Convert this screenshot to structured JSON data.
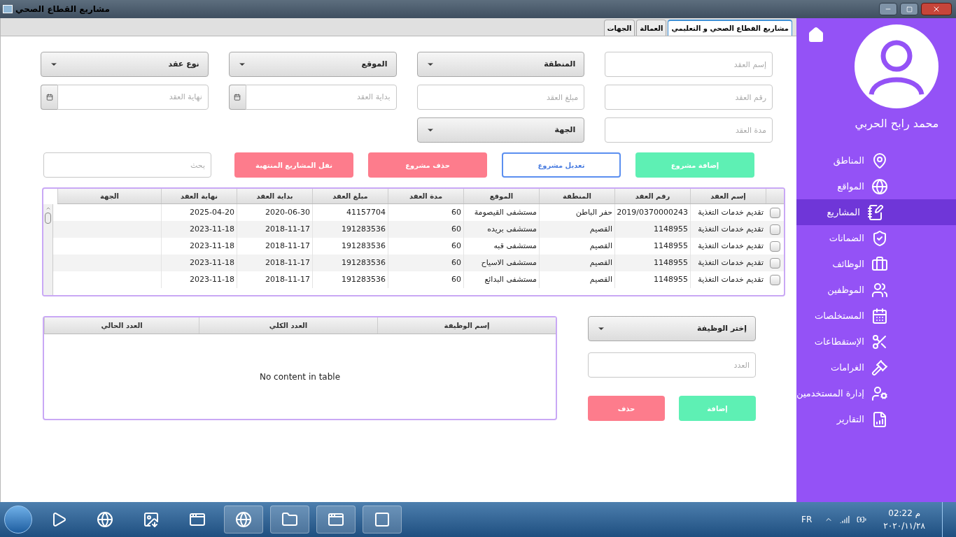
{
  "window": {
    "title": "مشاريع القطاع الصحي"
  },
  "tabs": [
    {
      "label": "مشاريع القطاع الصحي و التعليمي",
      "selected": true
    },
    {
      "label": "العمالة",
      "selected": false
    },
    {
      "label": "الجهات",
      "selected": false
    }
  ],
  "form": {
    "fields": [
      {
        "kind": "text",
        "placeholder": "إسم العقد"
      },
      {
        "kind": "combo",
        "label": "المنطقة"
      },
      {
        "kind": "combo",
        "label": "الموقع"
      },
      {
        "kind": "combo",
        "label": "نوع عقد"
      },
      {
        "kind": "text",
        "placeholder": "رقم العقد"
      },
      {
        "kind": "text",
        "placeholder": "مبلغ العقد"
      },
      {
        "kind": "date",
        "placeholder": "بداية العقد"
      },
      {
        "kind": "date",
        "placeholder": "نهاية العقد"
      },
      {
        "kind": "text",
        "placeholder": "مدة العقد"
      },
      {
        "kind": "combo",
        "label": "الجهة"
      }
    ]
  },
  "actions": [
    {
      "kind": "add",
      "label": "إضافة مشروع"
    },
    {
      "kind": "edit",
      "label": "تعديل مشروع"
    },
    {
      "kind": "delete",
      "label": "حذف مشروع"
    },
    {
      "kind": "delete",
      "label": "نقل المشاريع المنتهية"
    }
  ],
  "search": {
    "placeholder": "بحث"
  },
  "table": {
    "columns": [
      "إسم العقد",
      "رقم العقد",
      "المنطقة",
      "الموقع",
      "مدة العقد",
      "مبلغ العقد",
      "بداية العقد",
      "نهاية العقد",
      "الجهة"
    ],
    "rows": [
      {
        "checked": false,
        "cells": [
          "تقديم خدمات التغذية",
          "2019/0370000243",
          "حفر الباطن",
          "مستشفى القيصومة",
          "60",
          "41157704",
          "2020-06-30",
          "2025-04-20"
        ]
      },
      {
        "checked": false,
        "cells": [
          "تقديم خدمات التغذية",
          "1148955",
          "القصيم",
          "مستشفى بريده",
          "60",
          "191283536",
          "2018-11-17",
          "2023-11-18"
        ]
      },
      {
        "checked": false,
        "cells": [
          "تقديم خدمات التغذية",
          "1148955",
          "القصيم",
          "مستشفى قبه",
          "60",
          "191283536",
          "2018-11-17",
          "2023-11-18"
        ]
      },
      {
        "checked": false,
        "cells": [
          "تقديم خدمات التغذية",
          "1148955",
          "القصيم",
          "مستشفى الاسياح",
          "60",
          "191283536",
          "2018-11-17",
          "2023-11-18"
        ]
      },
      {
        "checked": false,
        "cells": [
          "تقديم خدمات التغذية",
          "1148955",
          "القصيم",
          "مستشفى البدائع",
          "60",
          "191283536",
          "2018-11-17",
          "2023-11-18"
        ]
      }
    ]
  },
  "jobs": {
    "combo_label": "إختر الوظيفة",
    "count_placeholder": "العدد",
    "actions": [
      {
        "kind": "add",
        "label": "إضافة"
      },
      {
        "kind": "delete",
        "label": "حذف"
      }
    ],
    "columns": [
      "إسم الوظيفة",
      "العدد الكلي",
      "العدد الحالي"
    ],
    "empty_text": "No content in table"
  },
  "sidebar": {
    "user_name": "محمد رابح الحربي",
    "items": [
      {
        "label": "المناطق",
        "selected": false
      },
      {
        "label": "المواقع",
        "selected": false
      },
      {
        "label": "المشاريع",
        "selected": true
      },
      {
        "label": "الضمانات",
        "selected": false
      },
      {
        "label": "الوظائف",
        "selected": false
      },
      {
        "label": "الموظفين",
        "selected": false
      },
      {
        "label": "المستخلصات",
        "selected": false
      },
      {
        "label": "الإستقطاعات",
        "selected": false
      },
      {
        "label": "الغرامات",
        "selected": false
      },
      {
        "label": "إدارة المستخدمين",
        "selected": false
      },
      {
        "label": "التقارير",
        "selected": false
      }
    ]
  },
  "taskbar": {
    "language": "FR",
    "time": "02:22 م",
    "date": "٢٠٢٠/١١/٢٨"
  }
}
